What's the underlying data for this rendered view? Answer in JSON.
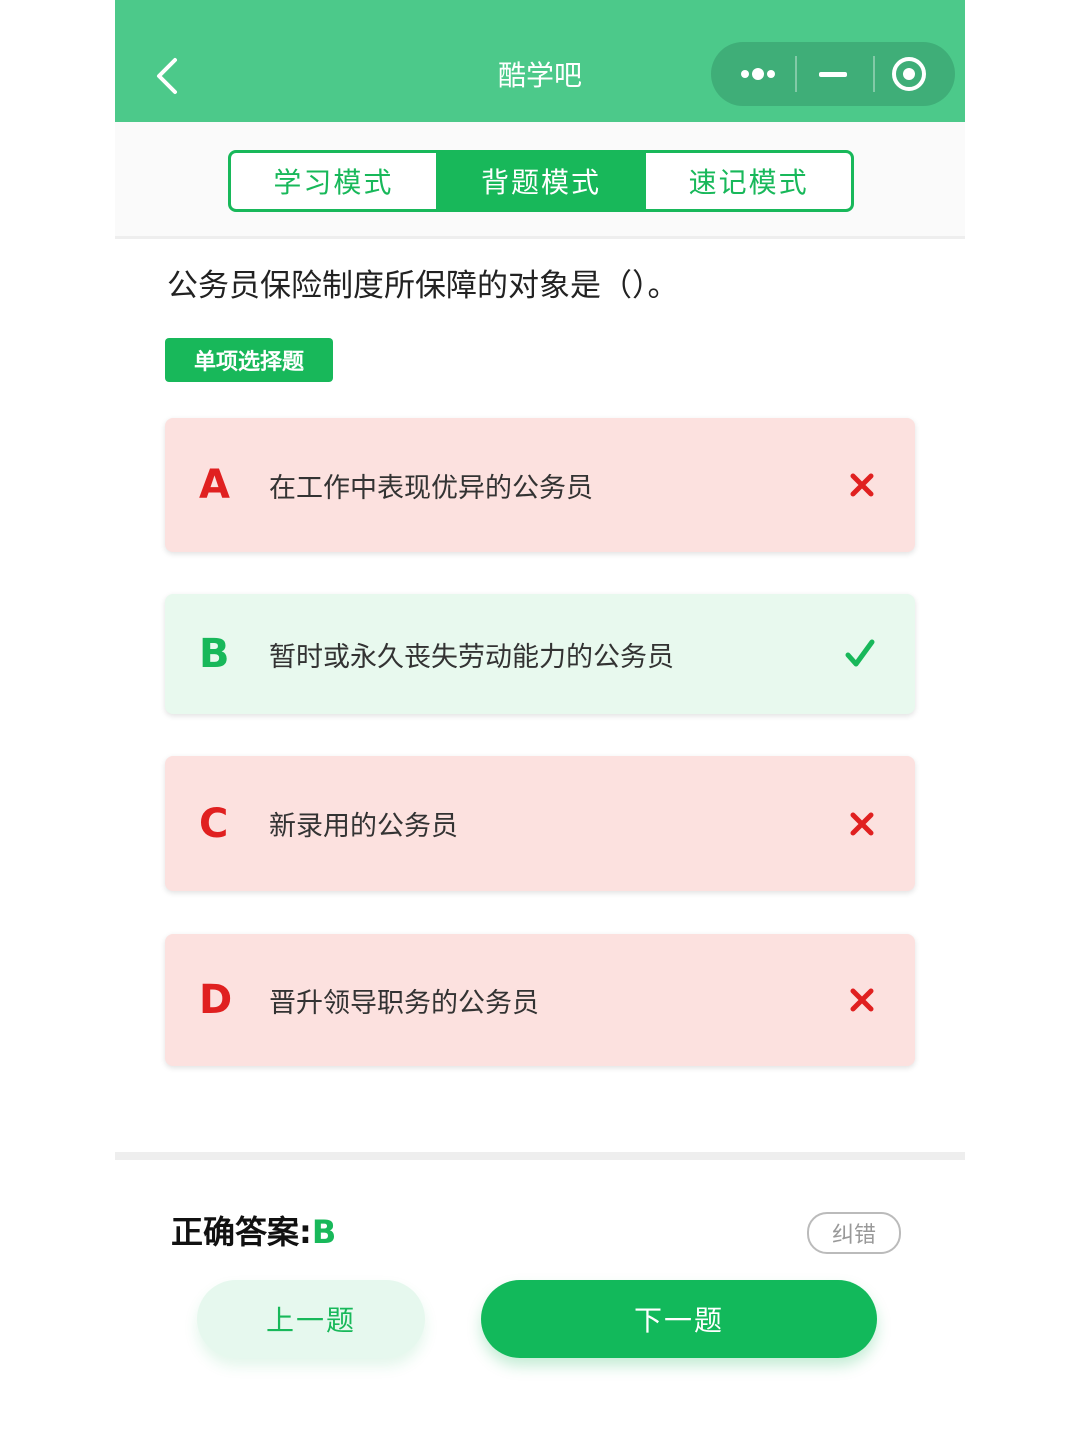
{
  "header": {
    "title": "酷学吧"
  },
  "tabs": [
    {
      "label": "学习模式",
      "active": false
    },
    {
      "label": "背题模式",
      "active": true
    },
    {
      "label": "速记模式",
      "active": false
    }
  ],
  "question": {
    "text": "公务员保险制度所保障的对象是（）。",
    "type": "单项选择题"
  },
  "options": [
    {
      "letter": "A",
      "text": "在工作中表现优异的公务员",
      "status": "wrong",
      "mark": "cross-icon"
    },
    {
      "letter": "B",
      "text": "暂时或永久丧失劳动能力的公务员",
      "status": "correct",
      "mark": "check-icon"
    },
    {
      "letter": "C",
      "text": "新录用的公务员",
      "status": "wrong",
      "mark": "cross-icon"
    },
    {
      "letter": "D",
      "text": "晋升领导职务的公务员",
      "status": "wrong",
      "mark": "cross-icon"
    }
  ],
  "answer": {
    "label": "正确答案:",
    "value": "B"
  },
  "buttons": {
    "report": "纠错",
    "prev": "上一题",
    "next": "下一题"
  },
  "colors": {
    "header": "#4cc98a",
    "accent": "#18b85a",
    "wrong": "#e02020",
    "wrong_bg": "#fce1df",
    "right_bg": "#e8f9ee"
  }
}
